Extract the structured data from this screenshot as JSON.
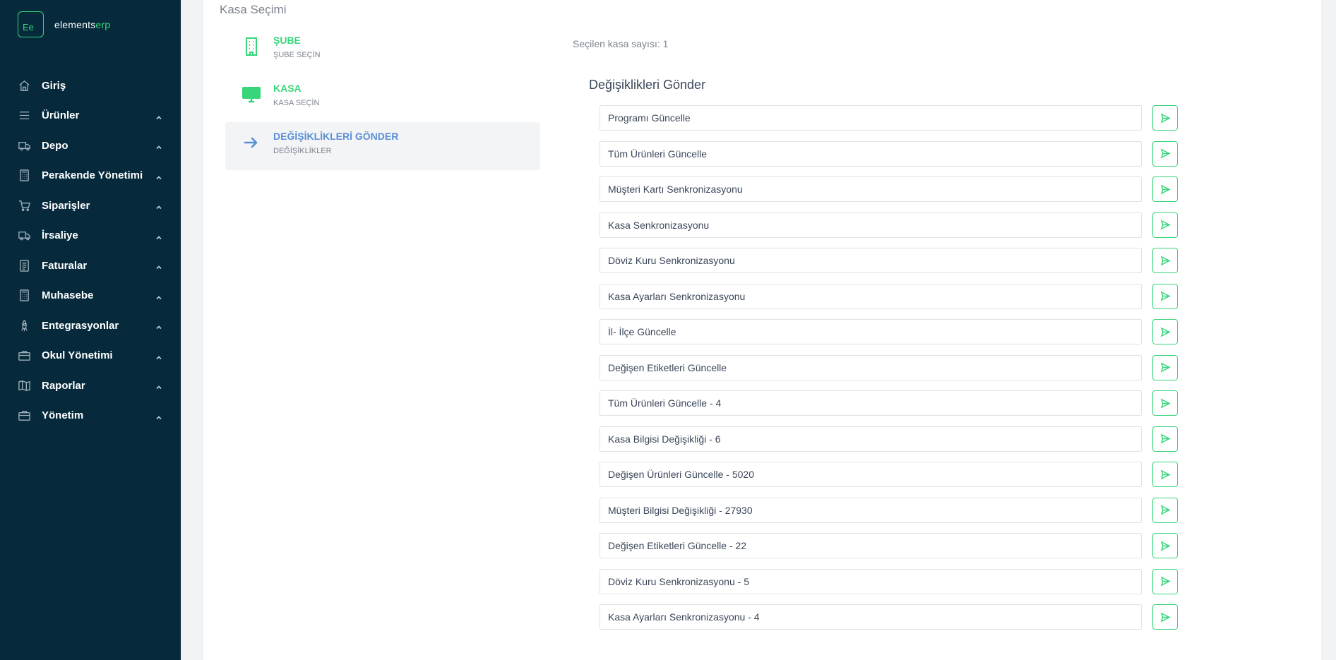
{
  "brand": {
    "logo_mark": "Ee",
    "name_main": "elements",
    "name_accent": "erp",
    "accent_color": "#37d67a",
    "sidebar_bg": "#062a3c"
  },
  "sidebar": {
    "items": [
      {
        "label": "Giriş",
        "icon": "home-icon",
        "has_chevron": false
      },
      {
        "label": "Ürünler",
        "icon": "list-icon",
        "has_chevron": true
      },
      {
        "label": "Depo",
        "icon": "truck-icon",
        "has_chevron": true
      },
      {
        "label": "Perakende Yönetimi",
        "icon": "calculator-icon",
        "has_chevron": true
      },
      {
        "label": "Siparişler",
        "icon": "cart-icon",
        "has_chevron": true
      },
      {
        "label": "İrsaliye",
        "icon": "truck-icon",
        "has_chevron": true
      },
      {
        "label": "Faturalar",
        "icon": "document-icon",
        "has_chevron": true
      },
      {
        "label": "Muhasebe",
        "icon": "calculator-icon",
        "has_chevron": true
      },
      {
        "label": "Entegrasyonlar",
        "icon": "rocket-icon",
        "has_chevron": true
      },
      {
        "label": "Okul Yönetimi",
        "icon": "briefcase-icon",
        "has_chevron": true
      },
      {
        "label": "Raporlar",
        "icon": "book-icon",
        "has_chevron": true
      },
      {
        "label": "Yönetim",
        "icon": "briefcase-icon",
        "has_chevron": true
      }
    ]
  },
  "main": {
    "card_title": "Kasa Seçimi",
    "steps": [
      {
        "title": "ŞUBE",
        "subtitle": "ŞUBE SEÇİN",
        "icon": "building-icon",
        "active": false
      },
      {
        "title": "KASA",
        "subtitle": "KASA SEÇİN",
        "icon": "monitor-icon",
        "active": false
      },
      {
        "title": "DEĞİŞİKLİKLERİ GÖNDER",
        "subtitle": "DEĞİŞİKLİKLER",
        "icon": "arrow-right-icon",
        "active": true
      }
    ],
    "selected_count": "Seçilen kasa sayısı: 1",
    "section_title": "Değişiklikleri Gönder",
    "actions": [
      "Programı Güncelle",
      "Tüm Ürünleri Güncelle",
      "Müşteri Kartı Senkronizasyonu",
      "Kasa Senkronizasyonu",
      "Döviz Kuru Senkronizasyonu",
      "Kasa Ayarları Senkronizasyonu",
      "İl- İlçe Güncelle",
      "Değişen Etiketleri Güncelle",
      "Tüm Ürünleri Güncelle - 4",
      "Kasa Bilgisi Değişikliği - 6",
      "Değişen Ürünleri Güncelle - 5020",
      "Müşteri Bilgisi Değişikliği - 27930",
      "Değişen Etiketleri Güncelle - 22",
      "Döviz Kuru Senkronizasyonu - 5",
      "Kasa Ayarları Senkronizasyonu - 4"
    ]
  }
}
